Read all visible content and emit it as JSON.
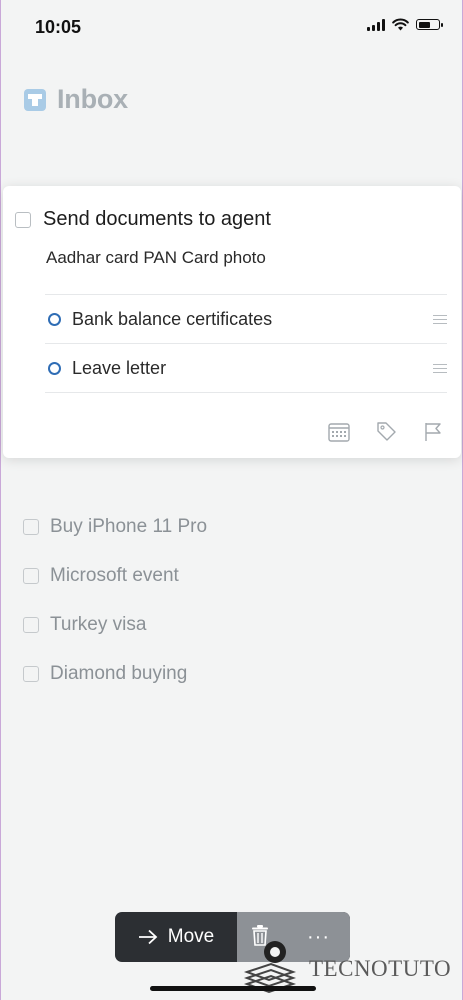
{
  "status_bar": {
    "time": "10:05"
  },
  "header": {
    "title": "Inbox"
  },
  "open_task": {
    "title": "Send documents to agent",
    "notes": "Aadhar card PAN Card photo",
    "checklist": [
      {
        "label": "Bank balance certificates"
      },
      {
        "label": "Leave letter"
      }
    ],
    "actions": [
      "calendar-icon",
      "tag-icon",
      "flag-icon"
    ]
  },
  "tasks": [
    {
      "label": "Buy iPhone 11 Pro"
    },
    {
      "label": "Microsoft event"
    },
    {
      "label": "Turkey visa"
    },
    {
      "label": "Diamond buying"
    }
  ],
  "action_bar": {
    "move_label": "Move",
    "more_label": "···"
  },
  "watermark": {
    "text": "TECNOTUTO"
  },
  "colors": {
    "accent": "#2f6db5",
    "background": "#f3f4f4",
    "action_bar": "#2c2f33"
  }
}
